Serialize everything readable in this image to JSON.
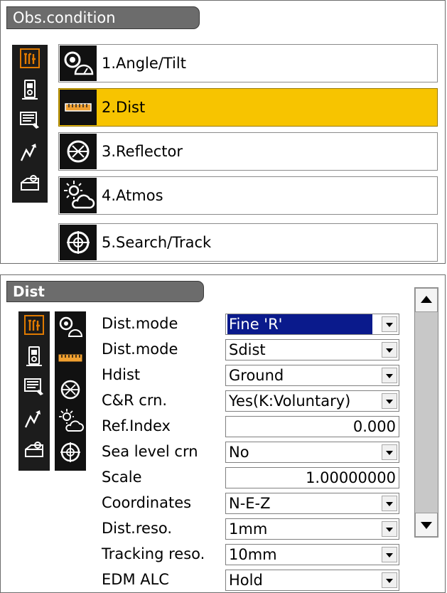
{
  "obs_panel": {
    "title": "Obs.condition",
    "menu": [
      {
        "label": "1.Angle/Tilt",
        "icon": "angle-tilt-icon",
        "selected": false
      },
      {
        "label": "2.Dist",
        "icon": "ruler-icon",
        "selected": true
      },
      {
        "label": "3.Reflector",
        "icon": "reflector-icon",
        "selected": false
      },
      {
        "label": "4.Atmos",
        "icon": "sun-cloud-icon",
        "selected": false
      },
      {
        "label": "5.Search/Track",
        "icon": "crosshair-icon",
        "selected": false
      }
    ]
  },
  "dist_panel": {
    "title": "Dist",
    "rows": [
      {
        "label": "Dist.mode",
        "value": "Fine 'R'",
        "type": "dropdown"
      },
      {
        "label": "Dist.mode",
        "value": "Sdist",
        "type": "dropdown"
      },
      {
        "label": "Hdist",
        "value": "Ground",
        "type": "dropdown"
      },
      {
        "label": "C&R crn.",
        "value": "Yes(K:Voluntary)",
        "type": "dropdown"
      },
      {
        "label": "Ref.Index",
        "value": "0.000",
        "type": "number"
      },
      {
        "label": "Sea level crn",
        "value": "No",
        "type": "dropdown"
      },
      {
        "label": "Scale",
        "value": "1.00000000",
        "type": "number"
      },
      {
        "label": "Coordinates",
        "value": "N-E-Z",
        "type": "dropdown"
      },
      {
        "label": "Dist.reso.",
        "value": "1mm",
        "type": "dropdown"
      },
      {
        "label": "Tracking reso.",
        "value": "10mm",
        "type": "dropdown"
      },
      {
        "label": "EDM ALC",
        "value": "Hold",
        "type": "dropdown"
      }
    ]
  },
  "colors": {
    "selected_menu": "#f7c400",
    "title_bar": "#6c6c6c",
    "sidebar": "#1c1c1c",
    "focus_highlight": "#0a1a8c",
    "icon_accent": "#e07a00"
  }
}
